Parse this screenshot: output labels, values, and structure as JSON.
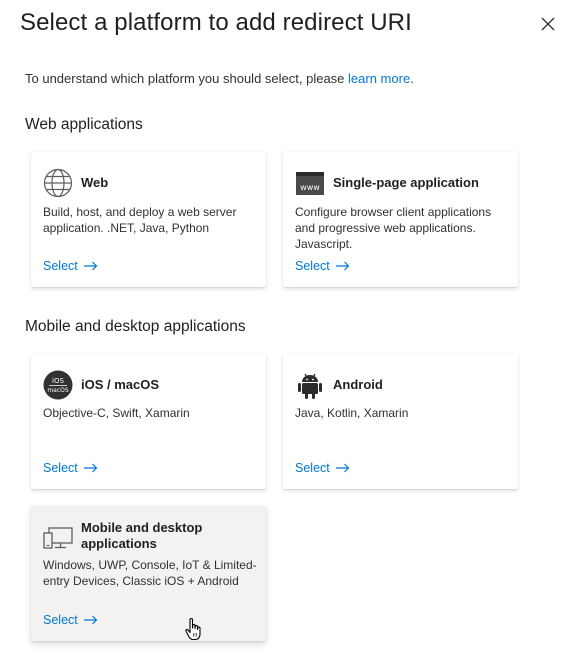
{
  "panel": {
    "title": "Select a platform to add redirect URI",
    "intro_text": "To understand which platform you should select, please ",
    "intro_link": "learn more",
    "intro_period": "."
  },
  "sections": {
    "web": "Web applications",
    "mobile": "Mobile and desktop applications"
  },
  "cards": {
    "web": {
      "name": "Web",
      "desc": "Build, host, and deploy a web server application. .NET, Java, Python",
      "select": "Select",
      "icon": "globe-icon"
    },
    "spa": {
      "name": "Single-page application",
      "desc": "Configure browser client applications and progressive web applications. Javascript.",
      "select": "Select",
      "icon": "browser-www-icon",
      "icon_text": "www"
    },
    "ios": {
      "name": "iOS / macOS",
      "desc": "Objective-C, Swift, Xamarin",
      "select": "Select",
      "icon": "ios-macos-icon",
      "icon_text_top": "iOS",
      "icon_text_bottom": "macOS"
    },
    "android": {
      "name": "Android",
      "desc": "Java, Kotlin, Xamarin",
      "select": "Select",
      "icon": "android-icon"
    },
    "desktop": {
      "name": "Mobile and desktop applications",
      "desc": "Windows, UWP, Console, IoT & Limited-entry Devices, Classic iOS + Android",
      "select": "Select",
      "icon": "desktop-mobile-icon"
    }
  },
  "colors": {
    "accent": "#0078d4",
    "text": "#201f1e",
    "hover_card": "#f3f2f1"
  }
}
